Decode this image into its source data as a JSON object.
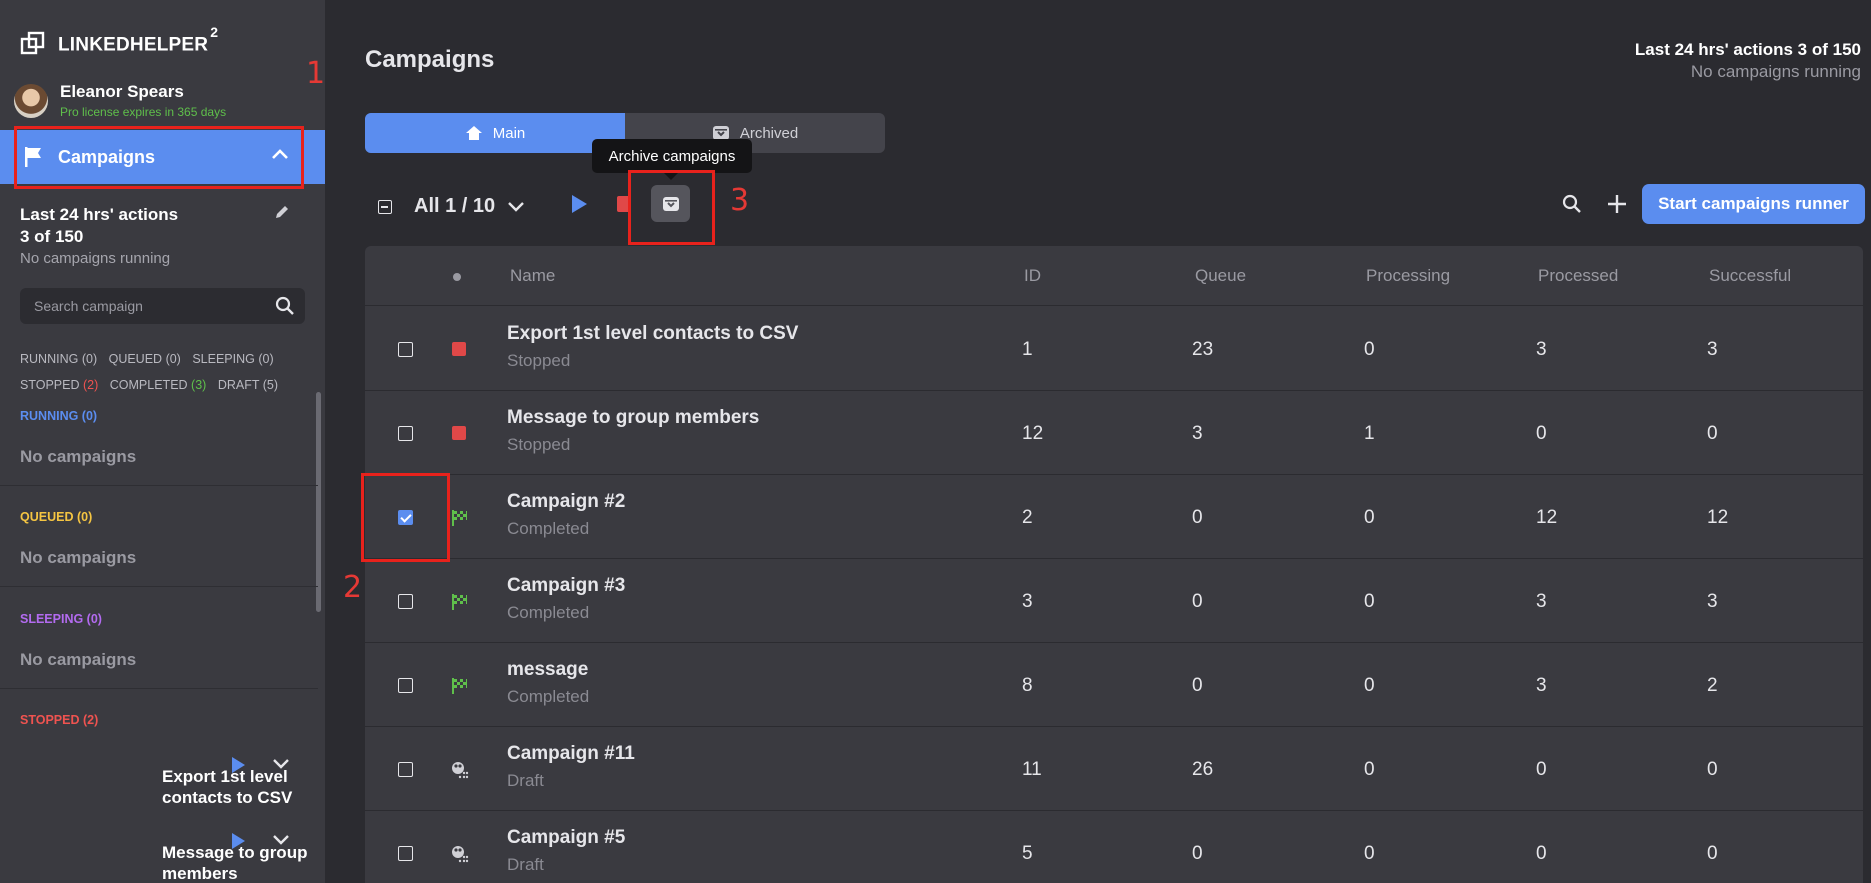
{
  "app": {
    "name": "LINKEDHELPER",
    "superscript": "2"
  },
  "user": {
    "name": "Eleanor Spears",
    "license": "Pro license expires in 365 days"
  },
  "sidebar": {
    "active_item": "Campaigns",
    "stats_line1": "Last 24 hrs' actions",
    "stats_line2": "3 of 150",
    "stats_status": "No campaigns running",
    "search_placeholder": "Search campaign",
    "counts": [
      {
        "label": "RUNNING",
        "count": "(0)"
      },
      {
        "label": "QUEUED",
        "count": "(0)"
      },
      {
        "label": "SLEEPING",
        "count": "(0)"
      },
      {
        "label": "STOPPED",
        "count": "(2)"
      },
      {
        "label": "COMPLETED",
        "count": "(3)"
      },
      {
        "label": "DRAFT",
        "count": "(5)"
      }
    ],
    "sections": [
      {
        "title": "RUNNING (0)",
        "empty": "No campaigns",
        "color": "#5b8def"
      },
      {
        "title": "QUEUED (0)",
        "empty": "No campaigns",
        "color": "#f5c542"
      },
      {
        "title": "SLEEPING (0)",
        "empty": "No campaigns",
        "color": "#b36bf0"
      },
      {
        "title": "STOPPED (2)",
        "color": "#ef5350"
      }
    ],
    "stopped_campaigns": [
      "Export 1st level contacts to CSV",
      "Message to group members"
    ]
  },
  "annotations": [
    "1",
    "2",
    "3"
  ],
  "header": {
    "title": "Campaigns",
    "actions": "Last 24 hrs' actions 3 of 150",
    "status": "No campaigns running"
  },
  "tabs": [
    {
      "label": "Main"
    },
    {
      "label": "Archived"
    }
  ],
  "toolbar": {
    "selection": "All 1 / 10",
    "tooltip": "Archive campaigns",
    "runner_label": "Start campaigns runner"
  },
  "table": {
    "columns": [
      "Name",
      "ID",
      "Queue",
      "Processing",
      "Processed",
      "Successful"
    ],
    "rows": [
      {
        "name": "Export 1st level contacts to CSV",
        "status": "Stopped",
        "id": "1",
        "queue": "23",
        "processing": "0",
        "processed": "3",
        "successful": "3",
        "checked": false,
        "icon": "stop-square-icon"
      },
      {
        "name": "Message to group members",
        "status": "Stopped",
        "id": "12",
        "queue": "3",
        "processing": "1",
        "processed": "0",
        "successful": "0",
        "checked": false,
        "icon": "stop-square-icon"
      },
      {
        "name": "Campaign #2",
        "status": "Completed",
        "id": "2",
        "queue": "0",
        "processing": "0",
        "processed": "12",
        "successful": "12",
        "checked": true,
        "icon": "checkered-flag-icon"
      },
      {
        "name": "Campaign #3",
        "status": "Completed",
        "id": "3",
        "queue": "0",
        "processing": "0",
        "processed": "3",
        "successful": "3",
        "checked": false,
        "icon": "checkered-flag-icon"
      },
      {
        "name": "message",
        "status": "Completed",
        "id": "8",
        "queue": "0",
        "processing": "0",
        "processed": "3",
        "successful": "2",
        "checked": false,
        "icon": "checkered-flag-icon"
      },
      {
        "name": "Campaign #11",
        "status": "Draft",
        "id": "11",
        "queue": "26",
        "processing": "0",
        "processed": "0",
        "successful": "0",
        "checked": false,
        "icon": "draft-dots-icon"
      },
      {
        "name": "Campaign #5",
        "status": "Draft",
        "id": "5",
        "queue": "0",
        "processing": "0",
        "processed": "0",
        "successful": "0",
        "checked": false,
        "icon": "draft-dots-icon"
      }
    ]
  },
  "colors": {
    "accent": "#5b8def",
    "stopped": "#e04848",
    "completed": "#5fbf4b",
    "annotation": "#e8221c"
  }
}
